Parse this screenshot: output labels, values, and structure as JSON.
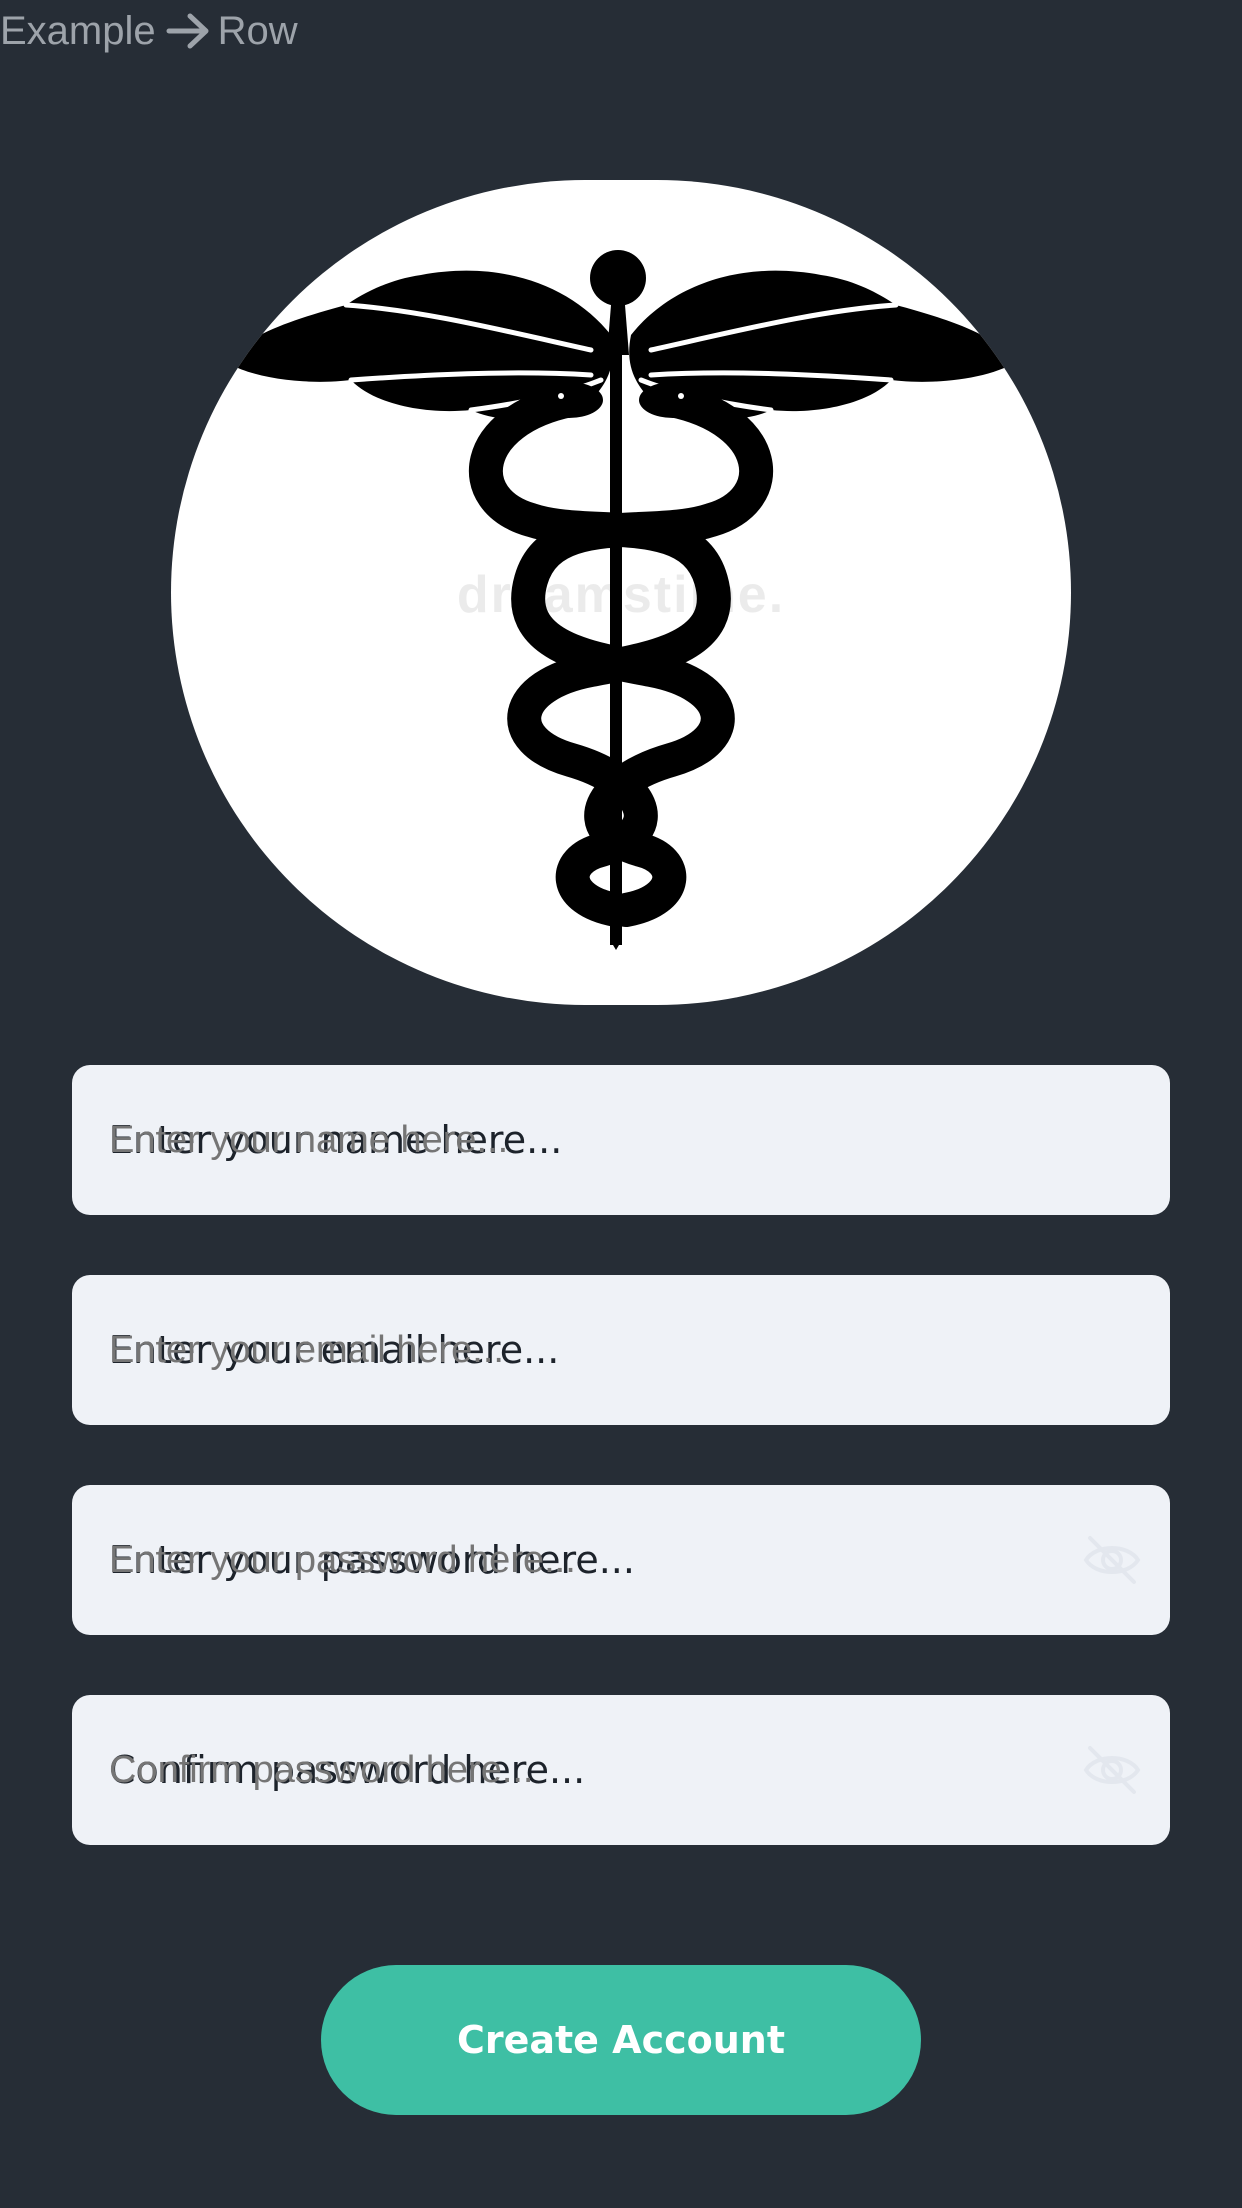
{
  "breadcrumb": {
    "parent": "Example",
    "separator_icon": "arrow-right-icon",
    "current": "Row"
  },
  "logo": {
    "icon": "caduceus-icon",
    "watermark": "dreamstime."
  },
  "form": {
    "name_placeholder": "Enter your name here...",
    "email_placeholder": "Enter your email here...",
    "password_placeholder": "Enter your password here...",
    "password_visibility_icon": "eye-off-icon",
    "confirm_placeholder": "Confirm password here...",
    "confirm_visibility_icon": "eye-off-icon"
  },
  "actions": {
    "create_account_label": "Create Account"
  },
  "colors": {
    "background": "#262d36",
    "field_background": "#eff2f7",
    "accent": "#3ebfa4",
    "logo_background": "#ffffff"
  }
}
